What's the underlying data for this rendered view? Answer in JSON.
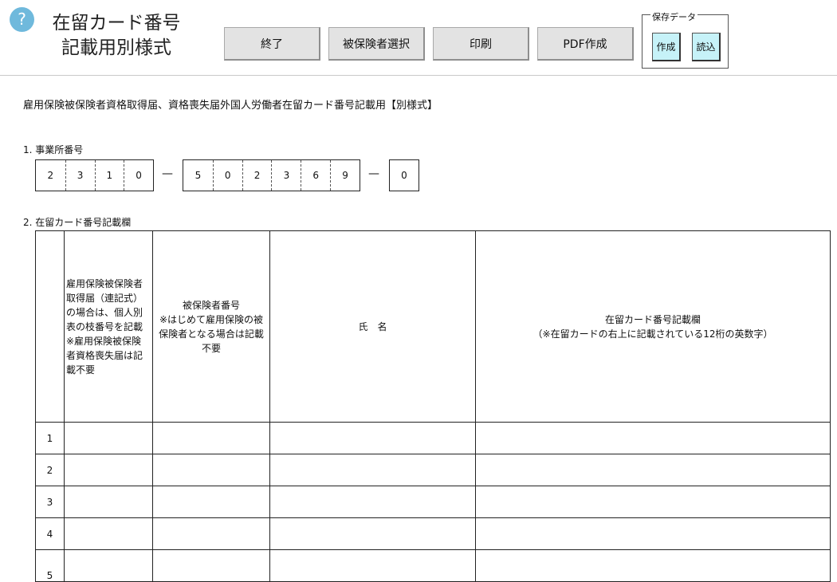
{
  "header": {
    "help_icon": "?",
    "title_line1": "在留カード番号",
    "title_line2": "記載用別様式"
  },
  "toolbar": {
    "buttons": [
      "終了",
      "被保険者選択",
      "印刷",
      "PDF作成"
    ]
  },
  "save_data": {
    "label": "保存データ",
    "create": "作成",
    "load": "読込"
  },
  "form": {
    "heading": "雇用保険被保険者資格取得届、資格喪失届外国人労働者在留カード番号記載用【別様式】",
    "section1_label": "1. 事業所番号",
    "office_number": {
      "part1": [
        "2",
        "3",
        "1",
        "0"
      ],
      "part2": [
        "5",
        "0",
        "2",
        "3",
        "6",
        "9"
      ],
      "part3": [
        "0"
      ],
      "separator": "—"
    },
    "section2_label": "2. 在留カード番号記載欄"
  },
  "table": {
    "col1_header": "雇用保険被保険者取得届（連記式）の場合は、個人別表の枝番号を記載\n※雇用保険被保険者資格喪失届は記載不要",
    "col2_header": "被保険者番号\n※はじめて雇用保険の被保険者となる場合は記載不要",
    "col3_header": "氏　名",
    "col4_header": "在留カード番号記載欄\n（※在留カードの右上に記載されている12桁の英数字）",
    "rows": [
      "1",
      "2",
      "3",
      "4",
      "5"
    ]
  }
}
